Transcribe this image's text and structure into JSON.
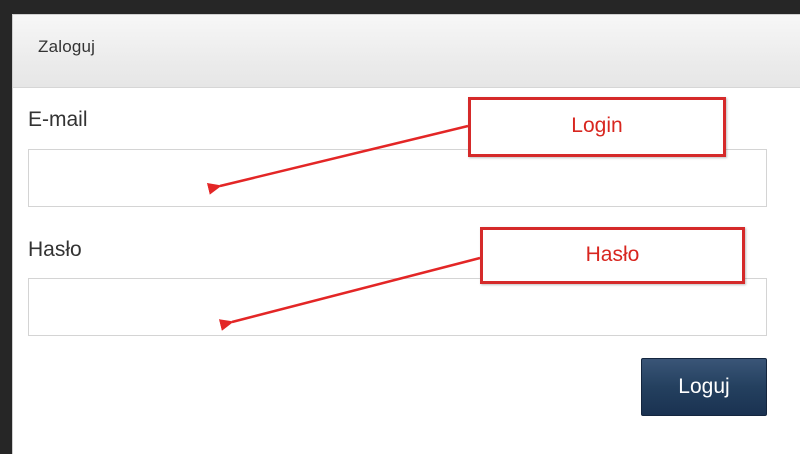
{
  "dialog": {
    "title": "Zaloguj"
  },
  "form": {
    "email": {
      "label": "E-mail",
      "value": "",
      "placeholder": ""
    },
    "password": {
      "label": "Hasło",
      "value": "",
      "placeholder": ""
    },
    "submit_label": "Loguj"
  },
  "annotations": {
    "login_note": "Login",
    "password_note": "Hasło",
    "color": "#d8261f"
  },
  "colors": {
    "button": "#24405f",
    "backdrop": "#262626"
  }
}
